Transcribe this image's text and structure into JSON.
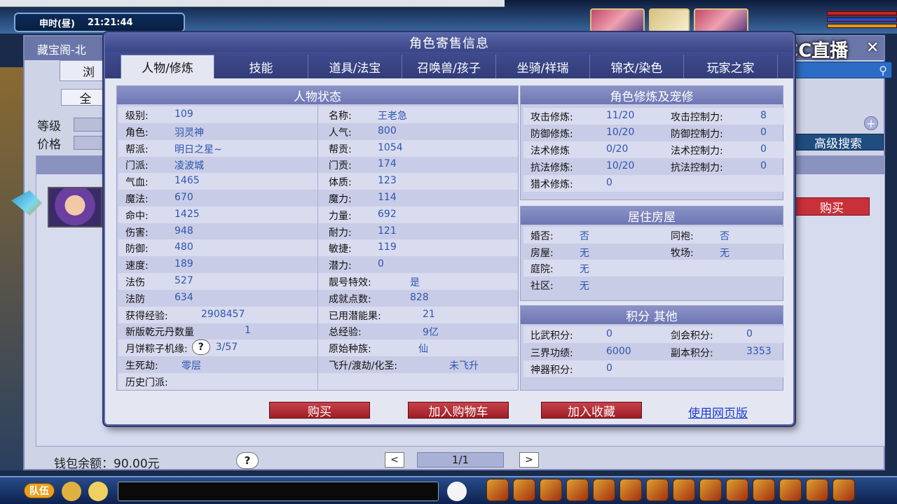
{
  "topbar": {
    "clock_period": "申时(昼)",
    "clock_time": "21:21:44"
  },
  "underlying": {
    "title": "藏宝阁-北",
    "browse_tab": "浏",
    "all_button": "全",
    "level_label": "等级",
    "price_label": "价格",
    "advanced_search": "高级搜索",
    "buy_label": "购买",
    "wallet": "钱包余额：90.00元",
    "help": "?",
    "pager": "1/1",
    "prev": "<",
    "next": ">"
  },
  "watermark": {
    "text": "CC直播"
  },
  "bottombar": {
    "team": "队伍"
  },
  "modal": {
    "title": "角色寄售信息",
    "tabs": [
      "人物/修炼",
      "技能",
      "道具/法宝",
      "召唤兽/孩子",
      "坐骑/祥瑞",
      "锦衣/染色",
      "玩家之家"
    ],
    "status": {
      "title": "人物状态",
      "left": [
        {
          "k": "级别:",
          "v": "109"
        },
        {
          "k": "角色:",
          "v": "羽灵神"
        },
        {
          "k": "帮派:",
          "v": "明日之星~"
        },
        {
          "k": "门派:",
          "v": "凌波城"
        },
        {
          "k": "气血:",
          "v": "1465"
        },
        {
          "k": "魔法:",
          "v": "670"
        },
        {
          "k": "命中:",
          "v": "1425"
        },
        {
          "k": "伤害:",
          "v": "948"
        },
        {
          "k": "防御:",
          "v": "480"
        },
        {
          "k": "速度:",
          "v": "189"
        },
        {
          "k": "法伤",
          "v": "527"
        },
        {
          "k": "法防",
          "v": "634"
        },
        {
          "k": "获得经验:",
          "v": "2908457"
        },
        {
          "k": "新版乾元丹数量",
          "v": "1"
        },
        {
          "k": "月饼粽子机缘:",
          "v": "3/57"
        },
        {
          "k": "生死劫:",
          "v": "零层"
        },
        {
          "k": "历史门派:",
          "v": ""
        }
      ],
      "right": [
        {
          "k": "名称:",
          "v": "王老急"
        },
        {
          "k": "人气:",
          "v": "800"
        },
        {
          "k": "帮贡:",
          "v": "1054"
        },
        {
          "k": "门贡:",
          "v": "174"
        },
        {
          "k": "体质:",
          "v": "123"
        },
        {
          "k": "魔力:",
          "v": "114"
        },
        {
          "k": "力量:",
          "v": "692"
        },
        {
          "k": "耐力:",
          "v": "121"
        },
        {
          "k": "敏捷:",
          "v": "119"
        },
        {
          "k": "潜力:",
          "v": "0"
        },
        {
          "k": "靓号特效:",
          "v": "是"
        },
        {
          "k": "成就点数:",
          "v": "828"
        },
        {
          "k": "已用潜能果:",
          "v": "21"
        },
        {
          "k": "总经验:",
          "v": "9亿"
        },
        {
          "k": "原始种族:",
          "v": "仙"
        },
        {
          "k": "飞升/渡劫/化圣:",
          "v": "未飞升"
        }
      ]
    },
    "cultivation": {
      "title": "角色修炼及宠修",
      "left": [
        {
          "k": "攻击修炼:",
          "v": "11/20"
        },
        {
          "k": "防御修炼:",
          "v": "10/20"
        },
        {
          "k": "法术修炼",
          "v": "0/20"
        },
        {
          "k": "抗法修炼:",
          "v": "10/20"
        },
        {
          "k": "猎术修炼:",
          "v": "0"
        }
      ],
      "right": [
        {
          "k": "攻击控制力:",
          "v": "8"
        },
        {
          "k": "防御控制力:",
          "v": "0"
        },
        {
          "k": "法术控制力:",
          "v": "0"
        },
        {
          "k": "抗法控制力:",
          "v": "0"
        }
      ]
    },
    "housing": {
      "title": "居住房屋",
      "left": [
        {
          "k": "婚否:",
          "v": "否"
        },
        {
          "k": "房屋:",
          "v": "无"
        },
        {
          "k": "庭院:",
          "v": "无"
        },
        {
          "k": "社区:",
          "v": "无"
        }
      ],
      "right": [
        {
          "k": "同袍:",
          "v": "否"
        },
        {
          "k": "牧场:",
          "v": "无"
        }
      ]
    },
    "points": {
      "title": "积分 其他",
      "left": [
        {
          "k": "比武积分:",
          "v": "0"
        },
        {
          "k": "三界功绩:",
          "v": "6000"
        },
        {
          "k": "神器积分:",
          "v": "0"
        }
      ],
      "right": [
        {
          "k": "剑会积分:",
          "v": "0"
        },
        {
          "k": "副本积分:",
          "v": "3353"
        }
      ]
    },
    "buttons": {
      "buy": "购买",
      "add_cart": "加入购物车",
      "add_favorite": "加入收藏",
      "web_version": "使用网页版"
    }
  }
}
